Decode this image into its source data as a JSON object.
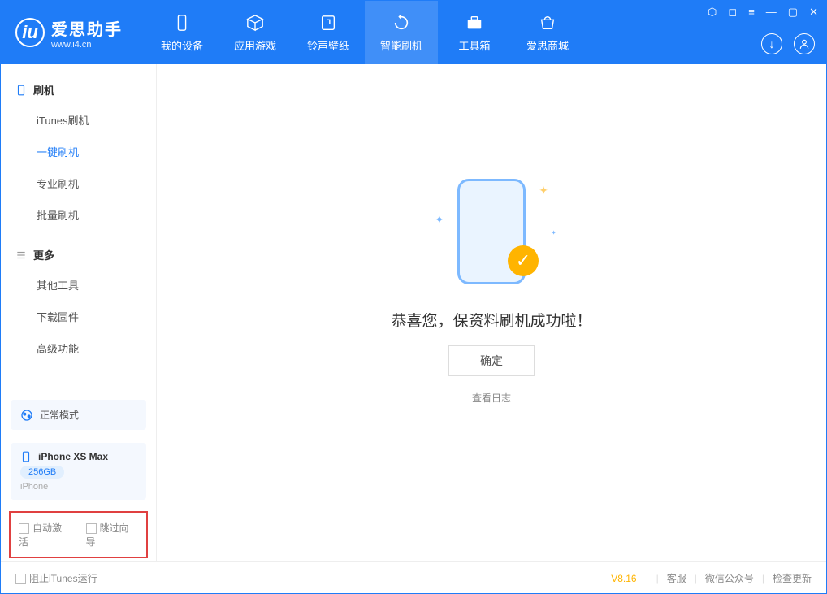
{
  "app": {
    "title": "爱思助手",
    "subtitle": "www.i4.cn"
  },
  "tabs": {
    "device": "我的设备",
    "apps": "应用游戏",
    "ringtone": "铃声壁纸",
    "flash": "智能刷机",
    "toolbox": "工具箱",
    "store": "爱思商城"
  },
  "sidebar": {
    "flash_title": "刷机",
    "itunes_flash": "iTunes刷机",
    "oneclick_flash": "一键刷机",
    "pro_flash": "专业刷机",
    "batch_flash": "批量刷机",
    "more_title": "更多",
    "other_tools": "其他工具",
    "download_fw": "下载固件",
    "advanced": "高级功能"
  },
  "device": {
    "mode": "正常模式",
    "name": "iPhone XS Max",
    "storage": "256GB",
    "type": "iPhone"
  },
  "options": {
    "auto_activate": "自动激活",
    "skip_guide": "跳过向导"
  },
  "main": {
    "success_msg": "恭喜您，保资料刷机成功啦！",
    "ok_button": "确定",
    "view_log": "查看日志"
  },
  "footer": {
    "block_itunes": "阻止iTunes运行",
    "version": "V8.16",
    "support": "客服",
    "wechat": "微信公众号",
    "check_update": "检查更新"
  }
}
